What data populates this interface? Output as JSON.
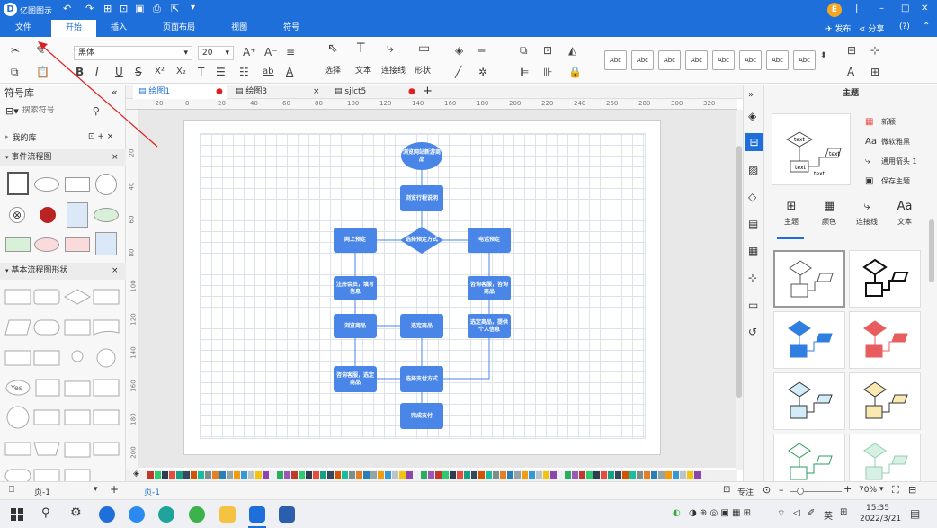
{
  "app": {
    "title": "亿图图示"
  },
  "titlebar_window": {
    "minimize": "–",
    "maximize": "□",
    "close": "✕",
    "user_initial": "E"
  },
  "menu": {
    "items": [
      "文件",
      "开始",
      "插入",
      "页面布局",
      "视图",
      "符号"
    ],
    "publish": "发布",
    "share": "分享",
    "help": "?"
  },
  "ribbon": {
    "font_name": "黑体",
    "font_size": "20",
    "bold": "B",
    "italic": "I",
    "underline": "U",
    "strike": "S",
    "superscript": "X²",
    "subscript": "X₂",
    "tool_labels": [
      "选择",
      "文本",
      "连接线",
      "形状"
    ],
    "style_thumb": "Abc"
  },
  "left_panel": {
    "title": "符号库",
    "search_placeholder": "搜索符号",
    "my_library": "我的库",
    "section1": "事件流程图",
    "section2": "基本流程图形状",
    "yes_label": "Yes"
  },
  "tabs": [
    {
      "label": "绘图1",
      "dirty": "●"
    },
    {
      "label": "绘图3",
      "close": "×"
    },
    {
      "label": "sjlct5",
      "dirty": "●"
    }
  ],
  "ruler": {
    "h": [
      "-20",
      "0",
      "20",
      "40",
      "60",
      "80",
      "100",
      "120",
      "140",
      "160",
      "180",
      "200",
      "220",
      "240",
      "260",
      "280",
      "300",
      "320"
    ],
    "v": [
      "20",
      "40",
      "60",
      "80",
      "100",
      "120",
      "140",
      "160",
      "180",
      "200"
    ]
  },
  "flowchart": {
    "start": "浏览网站新游商品",
    "step1": "浏览行程说明",
    "decision": "选择预定方式",
    "left1": "网上预定",
    "right1": "电话预定",
    "left2": "注册会员，填写信息",
    "right2": "咨询客服，咨询商品",
    "left3": "浏览商品",
    "mid3": "选定商品",
    "right3": "选定商品，提供个人信息",
    "left4": "咨询客服，选定商品",
    "pay": "选择支付方式",
    "done": "完成支付"
  },
  "right_panel": {
    "title": "主题",
    "options": [
      "新颖",
      "微软雅黑",
      "通用箭头 1",
      "保存主题"
    ],
    "tabs": [
      "主题",
      "颜色",
      "连接线",
      "文本"
    ],
    "preview_text": "text"
  },
  "status": {
    "page_selector": "页-1",
    "page_tab": "页-1",
    "focus": "专注",
    "zoom": "70%",
    "add": "+"
  },
  "taskbar": {
    "ime": "英",
    "time": "15:35",
    "date": "2022/3/21"
  },
  "colors": {
    "brand": "#1e6fd9",
    "node": "#4a86e8",
    "annotation": "#e02020"
  }
}
